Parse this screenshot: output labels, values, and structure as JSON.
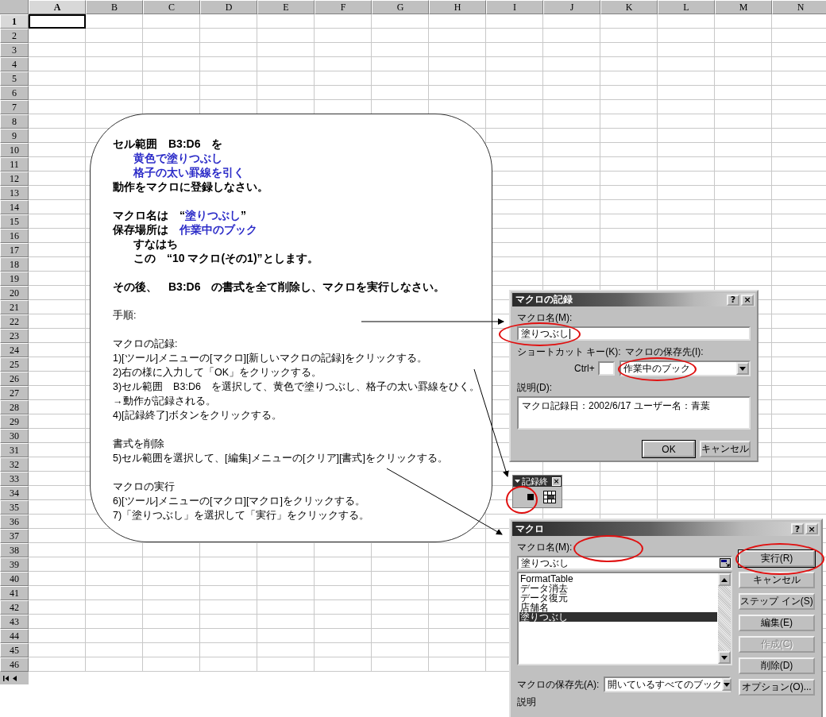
{
  "sheet": {
    "columns": [
      {
        "label": "A",
        "selected": true
      },
      {
        "label": "B",
        "selected": false
      },
      {
        "label": "C",
        "selected": false
      },
      {
        "label": "D",
        "selected": false
      },
      {
        "label": "E",
        "selected": false
      },
      {
        "label": "F",
        "selected": false
      },
      {
        "label": "G",
        "selected": false
      },
      {
        "label": "H",
        "selected": false
      },
      {
        "label": "I",
        "selected": false
      },
      {
        "label": "J",
        "selected": false
      },
      {
        "label": "K",
        "selected": false
      },
      {
        "label": "L",
        "selected": false
      },
      {
        "label": "M",
        "selected": false
      },
      {
        "label": "N",
        "selected": false
      }
    ],
    "rows": [
      {
        "label": "1",
        "selected": true
      },
      {
        "label": "2",
        "selected": false
      },
      {
        "label": "3",
        "selected": false
      },
      {
        "label": "4",
        "selected": false
      },
      {
        "label": "5",
        "selected": false
      },
      {
        "label": "6",
        "selected": false
      },
      {
        "label": "7",
        "selected": false
      },
      {
        "label": "8",
        "selected": false
      },
      {
        "label": "9",
        "selected": false
      },
      {
        "label": "10",
        "selected": false
      },
      {
        "label": "11",
        "selected": false
      },
      {
        "label": "12",
        "selected": false
      },
      {
        "label": "13",
        "selected": false
      },
      {
        "label": "14",
        "selected": false
      },
      {
        "label": "15",
        "selected": false
      },
      {
        "label": "16",
        "selected": false
      },
      {
        "label": "17",
        "selected": false
      },
      {
        "label": "18",
        "selected": false
      },
      {
        "label": "19",
        "selected": false
      },
      {
        "label": "20",
        "selected": false
      },
      {
        "label": "21",
        "selected": false
      },
      {
        "label": "22",
        "selected": false
      },
      {
        "label": "23",
        "selected": false
      },
      {
        "label": "24",
        "selected": false
      },
      {
        "label": "25",
        "selected": false
      },
      {
        "label": "26",
        "selected": false
      },
      {
        "label": "27",
        "selected": false
      },
      {
        "label": "28",
        "selected": false
      },
      {
        "label": "29",
        "selected": false
      },
      {
        "label": "30",
        "selected": false
      },
      {
        "label": "31",
        "selected": false
      },
      {
        "label": "32",
        "selected": false
      },
      {
        "label": "33",
        "selected": false
      },
      {
        "label": "34",
        "selected": false
      },
      {
        "label": "35",
        "selected": false
      },
      {
        "label": "36",
        "selected": false
      },
      {
        "label": "37",
        "selected": false
      },
      {
        "label": "38",
        "selected": false
      },
      {
        "label": "39",
        "selected": false
      },
      {
        "label": "40",
        "selected": false
      },
      {
        "label": "41",
        "selected": false
      },
      {
        "label": "42",
        "selected": false
      },
      {
        "label": "43",
        "selected": false
      },
      {
        "label": "44",
        "selected": false
      },
      {
        "label": "45",
        "selected": false
      },
      {
        "label": "46",
        "selected": false
      }
    ]
  },
  "callout": {
    "paragraphs": [
      {
        "kind": "bold",
        "lines": [
          {
            "text": "セル範囲　B3:D6　を",
            "indent": false,
            "highlight": false
          },
          {
            "text": "黄色で塗りつぶし",
            "indent": true,
            "highlight": true
          },
          {
            "text": "格子の太い罫線を引く",
            "indent": true,
            "highlight": true
          },
          {
            "text": "動作をマクロに登録しなさい。",
            "indent": false,
            "highlight": false
          }
        ]
      },
      {
        "kind": "bold",
        "lines": [
          {
            "indent": false,
            "parts": [
              {
                "text": "マクロ名は　“",
                "highlight": false
              },
              {
                "text": "塗りつぶし",
                "highlight": true
              },
              {
                "text": "”",
                "highlight": false
              }
            ]
          },
          {
            "indent": false,
            "parts": [
              {
                "text": "保存場所は　",
                "highlight": false
              },
              {
                "text": "作業中のブック",
                "highlight": true
              }
            ]
          },
          {
            "text": "すなはち",
            "indent": true,
            "highlight": false
          },
          {
            "text": "この　“10 マクロ(その1)”とします。",
            "indent": true,
            "highlight": false
          }
        ]
      },
      {
        "kind": "bold",
        "lines": [
          {
            "text": "その後、　B3:D6　の書式を全て削除し、マクロを実行しなさい。",
            "indent": false,
            "highlight": false
          }
        ]
      },
      {
        "kind": "plain",
        "lines": [
          {
            "text": "手順:",
            "indent": false,
            "highlight": false
          }
        ]
      },
      {
        "kind": "plain",
        "lines": [
          {
            "text": "マクロの記録:",
            "indent": false,
            "highlight": false
          },
          {
            "text": "1)[ツール]メニューの[マクロ][新しいマクロの記録]をクリックする。",
            "indent": false,
            "highlight": false
          },
          {
            "text": "2)右の様に入力して「OK」をクリックする。",
            "indent": false,
            "highlight": false
          },
          {
            "text": "3)セル範囲　B3:D6　を選択して、黄色で塗りつぶし、格子の太い罫線をひく。→動作が記録される。",
            "indent": false,
            "highlight": false
          },
          {
            "text": "4)[記録終了]ボタンをクリックする。",
            "indent": false,
            "highlight": false
          }
        ]
      },
      {
        "kind": "plain",
        "lines": [
          {
            "text": "書式を削除",
            "indent": false,
            "highlight": false
          },
          {
            "text": "5)セル範囲を選択して、[編集]メニューの[クリア][書式]をクリックする。",
            "indent": false,
            "highlight": false
          }
        ]
      },
      {
        "kind": "plain",
        "lines": [
          {
            "text": "マクロの実行",
            "indent": false,
            "highlight": false
          },
          {
            "text": "6)[ツール]メニューの[マクロ][マクロ]をクリックする。",
            "indent": false,
            "highlight": false
          },
          {
            "text": "7)「塗りつぶし」を選択して「実行」をクリックする。",
            "indent": false,
            "highlight": false
          }
        ]
      }
    ]
  },
  "record_dialog": {
    "title": "マクロの記録",
    "help_button": "?",
    "close_button": "×",
    "name_label": "マクロ名(M):",
    "name_value": "塗りつぶし",
    "shortcut_label": "ショートカット キー(K):",
    "ctrl_label": "Ctrl+",
    "store_label": "マクロの保存先(I):",
    "store_value": "作業中のブック",
    "description_label": "説明(D):",
    "description_value": "マクロ記録日：2002/6/17  ユーザー名：青葉",
    "buttons": [
      {
        "label": "OK",
        "default": true
      },
      {
        "label": "キャンセル",
        "default": false
      }
    ]
  },
  "record_toolbar": {
    "title": "記録終",
    "close_button": "×"
  },
  "macro_dialog": {
    "title": "マクロ",
    "help_button": "?",
    "close_button": "×",
    "name_label": "マクロ名(M):",
    "name_value": "塗りつぶし",
    "macros": [
      {
        "label": "FormatTable",
        "selected": false
      },
      {
        "label": "データ消去",
        "selected": false
      },
      {
        "label": "データ復元",
        "selected": false
      },
      {
        "label": "店舗名",
        "selected": false
      },
      {
        "label": "塗りつぶし",
        "selected": true
      }
    ],
    "buttons": [
      {
        "label": "実行(R)",
        "default": true,
        "disabled": false
      },
      {
        "label": "キャンセル",
        "default": false,
        "disabled": false
      },
      {
        "label": "ステップ イン(S)",
        "default": false,
        "disabled": false
      },
      {
        "label": "編集(E)",
        "default": false,
        "disabled": false
      },
      {
        "label": "作成(C)",
        "default": false,
        "disabled": true
      },
      {
        "label": "削除(D)",
        "default": false,
        "disabled": false
      },
      {
        "label": "オプション(O)...",
        "default": false,
        "disabled": false
      }
    ],
    "store_label": "マクロの保存先(A):",
    "store_value": "開いているすべてのブック",
    "description_label": "説明"
  }
}
